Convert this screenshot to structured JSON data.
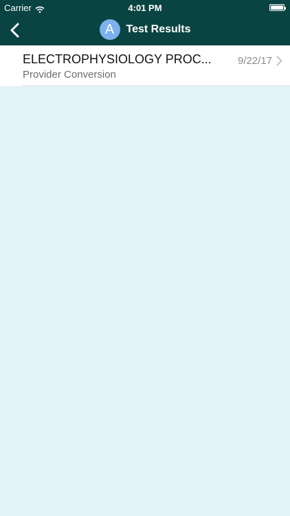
{
  "status_bar": {
    "carrier": "Carrier",
    "time": "4:01 PM"
  },
  "nav": {
    "avatar_initial": "A",
    "title": "Test Results"
  },
  "results": [
    {
      "title": "ELECTROPHYSIOLOGY PROC...",
      "subtitle": "Provider Conversion",
      "date": "9/22/17"
    }
  ],
  "colors": {
    "header_bg": "#0a4442",
    "page_bg": "#e2f2f6",
    "avatar_bg": "#7db0ee"
  },
  "icons": {
    "wifi": "wifi-icon",
    "battery": "battery-icon",
    "back": "back-chevron-icon",
    "row_chevron": "chevron-right-icon"
  }
}
